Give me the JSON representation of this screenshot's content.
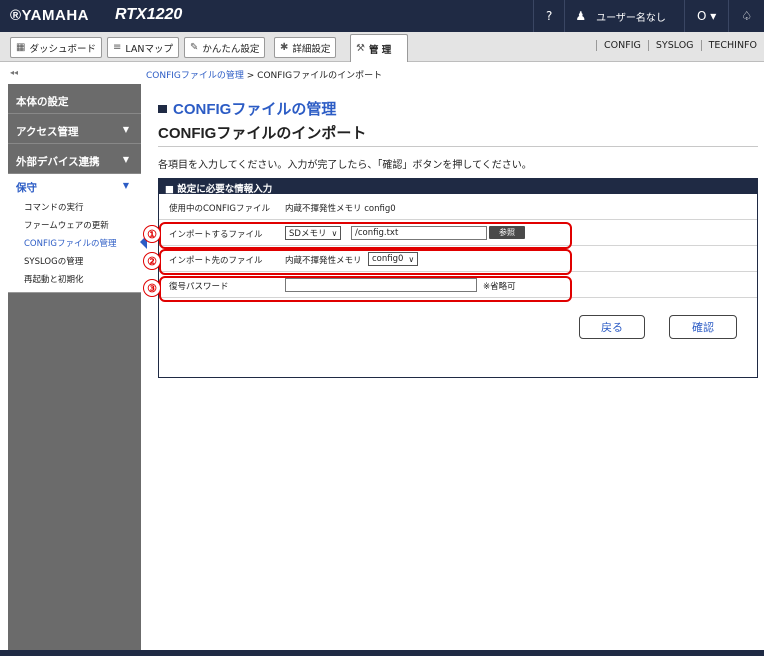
{
  "topbar": {
    "brand": "®YAMAHA",
    "model": "RTX1220",
    "help_icon": "?",
    "user_label": "ユーザー名なし",
    "status_icon": "O ▾",
    "bell_icon": "bell-icon"
  },
  "menubar": {
    "dashboard": "ダッシュボード",
    "lanmap": "LANマップ",
    "easy_setup": "かんたん設定",
    "advanced": "詳細設定",
    "management": "管 理",
    "quick_links": [
      "CONFIG",
      "SYSLOG",
      "TECHINFO"
    ]
  },
  "breadcrumb": {
    "collapse": "◂◂",
    "parent": "CONFIGファイルの管理",
    "separator": " > ",
    "current": "CONFIGファイルのインポート"
  },
  "sidebar": {
    "groups": [
      {
        "label": "本体の設定",
        "arrow": ""
      },
      {
        "label": "アクセス管理",
        "arrow": "▼"
      },
      {
        "label": "外部デバイス連携",
        "arrow": "▼"
      },
      {
        "label": "保守",
        "arrow": "▼"
      }
    ],
    "items": [
      "コマンドの実行",
      "ファームウェアの更新",
      "CONFIGファイルの管理",
      "SYSLOGの管理",
      "再起動と初期化"
    ]
  },
  "main": {
    "section_title": "CONFIGファイルの管理",
    "page_title": "CONFIGファイルのインポート",
    "description": "各項目を入力してください。入力が完了したら、「確認」ボタンを押してください。",
    "panel_title": "■ 設定に必要な情報入力",
    "rows": {
      "current_config_label": "使用中のCONFIGファイル",
      "current_config_value": "内蔵不揮発性メモリ  config0",
      "import_file_label": "インポートするファイル",
      "import_source": "SDメモリ",
      "import_path": "/config.txt",
      "browse": "参照",
      "dest_label": "インポート先のファイル",
      "dest_prefix": "内蔵不揮発性メモリ",
      "dest_value": "config0",
      "password_label": "復号パスワード",
      "password_value": "",
      "password_note": "※省略可"
    },
    "markers": [
      "①",
      "②",
      "③"
    ],
    "back_button": "戻る",
    "confirm_button": "確認"
  },
  "colors": {
    "navy": "#1f2a44",
    "accent_blue": "#2c5cc5",
    "highlight_red": "#e00000",
    "sidebar_gray": "#6b6b6b"
  }
}
